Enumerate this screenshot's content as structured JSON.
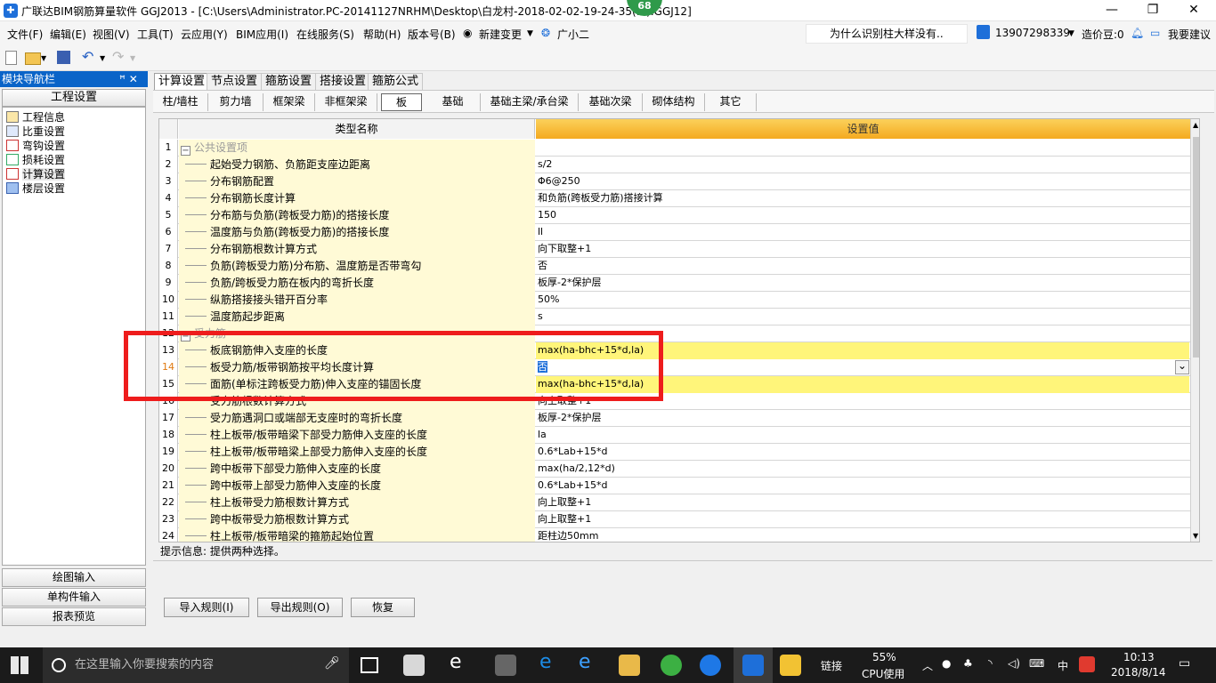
{
  "window": {
    "title": "广联达BIM钢筋算量软件 GGJ2013 - [C:\\Users\\Administrator.PC-20141127NRHM\\Desktop\\白龙村-2018-02-02-19-24-35(...).GGJ12]",
    "badge": "68",
    "min_glyph": "—",
    "max_glyph": "❐",
    "close_glyph": "✕"
  },
  "menu": {
    "items": [
      "文件(F)",
      "编辑(E)",
      "视图(V)",
      "工具(T)",
      "云应用(Y)",
      "BIM应用(I)",
      "在线服务(S)",
      "帮助(H)",
      "版本号(B)"
    ],
    "new_change": "新建变更",
    "assistant": "广小二",
    "hint_text": "为什么识别柱大样没有..",
    "phone": "13907298339",
    "cost_beans": "造价豆:0",
    "suggest": "我要建议"
  },
  "nav": {
    "header": "模块导航栏",
    "pin": "ꟸ  ✕",
    "section": "工程设置",
    "tree": [
      "工程信息",
      "比重设置",
      "弯钩设置",
      "损耗设置",
      "计算设置",
      "楼层设置"
    ],
    "selected": "计算设置",
    "bottom_buttons": [
      "绘图输入",
      "单构件输入",
      "报表预览"
    ]
  },
  "tabs": [
    "计算设置",
    "节点设置",
    "箍筋设置",
    "搭接设置",
    "箍筋公式"
  ],
  "subtabs": [
    "柱/墙柱",
    "剪力墙",
    "框架梁",
    "非框架梁",
    "板",
    "基础",
    "基础主梁/承台梁",
    "基础次梁",
    "砌体结构",
    "其它"
  ],
  "grid": {
    "col_name": "类型名称",
    "col_value": "设置值",
    "rows": [
      {
        "n": "1",
        "name": "公共设置项",
        "value": "",
        "group": true
      },
      {
        "n": "2",
        "name": "起始受力钢筋、负筋距支座边距离",
        "value": "s/2"
      },
      {
        "n": "3",
        "name": "分布钢筋配置",
        "value": "Φ6@250"
      },
      {
        "n": "4",
        "name": "分布钢筋长度计算",
        "value": "和负筋(跨板受力筋)搭接计算"
      },
      {
        "n": "5",
        "name": "分布筋与负筋(跨板受力筋)的搭接长度",
        "value": "150"
      },
      {
        "n": "6",
        "name": "温度筋与负筋(跨板受力筋)的搭接长度",
        "value": "ll"
      },
      {
        "n": "7",
        "name": "分布钢筋根数计算方式",
        "value": "向下取整+1"
      },
      {
        "n": "8",
        "name": "负筋(跨板受力筋)分布筋、温度筋是否带弯勾",
        "value": "否"
      },
      {
        "n": "9",
        "name": "负筋/跨板受力筋在板内的弯折长度",
        "value": "板厚-2*保护层"
      },
      {
        "n": "10",
        "name": "纵筋搭接接头错开百分率",
        "value": "50%"
      },
      {
        "n": "11",
        "name": "温度筋起步距离",
        "value": "s"
      },
      {
        "n": "12",
        "name": "受力筋",
        "value": "",
        "group": true
      },
      {
        "n": "13",
        "name": "板底钢筋伸入支座的长度",
        "value": "max(ha-bhc+15*d,la)",
        "hi": true
      },
      {
        "n": "14",
        "name": "板受力筋/板带钢筋按平均长度计算",
        "value": "否",
        "edit": true
      },
      {
        "n": "15",
        "name": "面筋(单标注跨板受力筋)伸入支座的锚固长度",
        "value": "max(ha-bhc+15*d,la)",
        "hi": true
      },
      {
        "n": "16",
        "name": "受力筋根数计算方式",
        "value": "向上取整+1"
      },
      {
        "n": "17",
        "name": "受力筋遇洞口或端部无支座时的弯折长度",
        "value": "板厚-2*保护层"
      },
      {
        "n": "18",
        "name": "柱上板带/板带暗梁下部受力筋伸入支座的长度",
        "value": "la"
      },
      {
        "n": "19",
        "name": "柱上板带/板带暗梁上部受力筋伸入支座的长度",
        "value": "0.6*Lab+15*d"
      },
      {
        "n": "20",
        "name": "跨中板带下部受力筋伸入支座的长度",
        "value": "max(ha/2,12*d)"
      },
      {
        "n": "21",
        "name": "跨中板带上部受力筋伸入支座的长度",
        "value": "0.6*Lab+15*d"
      },
      {
        "n": "22",
        "name": "柱上板带受力筋根数计算方式",
        "value": "向上取整+1"
      },
      {
        "n": "23",
        "name": "跨中板带受力筋根数计算方式",
        "value": "向上取整+1"
      },
      {
        "n": "24",
        "name": "柱上板带/板带暗梁的箍筋起始位置",
        "value": "距柱边50mm"
      }
    ]
  },
  "hint": "提示信息: 提供两种选择。",
  "buttons": {
    "import": "导入规则(I)",
    "export": "导出规则(O)",
    "restore": "恢复"
  },
  "taskbar": {
    "search_placeholder": "在这里输入你要搜索的内容",
    "link": "链接",
    "cpu_pct": "55%",
    "cpu_label": "CPU使用",
    "ime": "中",
    "time": "10:13",
    "date": "2018/8/14"
  },
  "colors": {
    "accent": "#0a64c8",
    "header_orange": "#f7b92f",
    "row_name_bg": "#fffad6",
    "highlight": "#fff57a",
    "annotation_red": "#ee1c1c"
  }
}
